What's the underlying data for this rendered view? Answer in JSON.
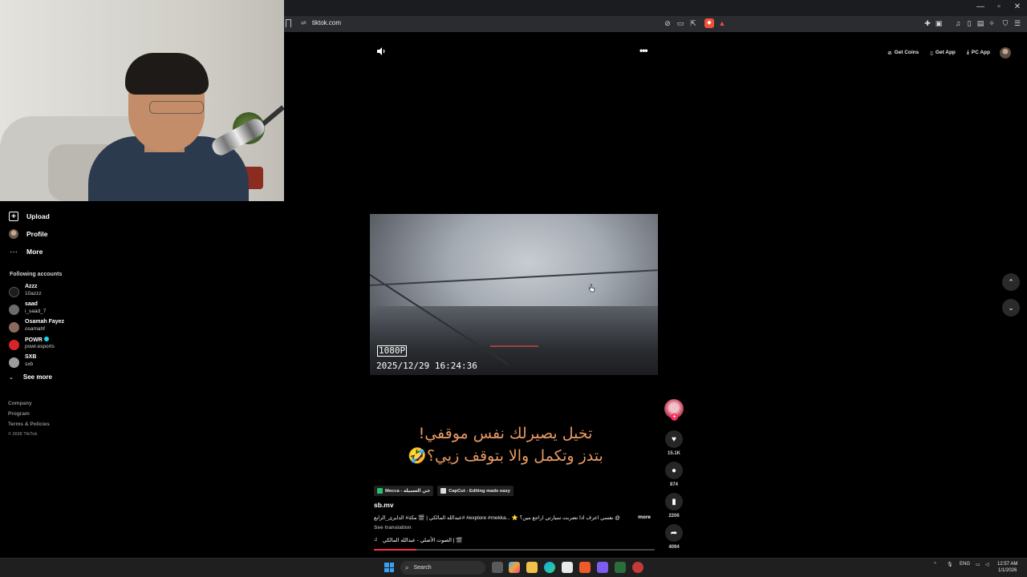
{
  "browser": {
    "url": "tiktok.com",
    "window_controls": [
      "—",
      "▫",
      "✕"
    ]
  },
  "sidebar": {
    "items": [
      {
        "label": "Upload",
        "icon": "upload-icon"
      },
      {
        "label": "Profile",
        "icon": "profile-avatar"
      },
      {
        "label": "More",
        "icon": "more-dots-icon"
      }
    ],
    "following_title": "Following accounts",
    "accounts": [
      {
        "name": "Azzz",
        "handle": "10azzz",
        "color": "#1c1c1c"
      },
      {
        "name": "saad",
        "handle": "i_saad_7",
        "color": "#6b6b6b"
      },
      {
        "name": "Osamah Fayez",
        "handle": "osamahf",
        "color": "#8a6a5e"
      },
      {
        "name": "POWR",
        "handle": "powr.esports",
        "color": "#d6262a",
        "verified": true
      },
      {
        "name": "SXB",
        "handle": "sxb",
        "color": "#9d9d9d"
      }
    ],
    "see_more": "See more",
    "footer": [
      "Company",
      "Program",
      "Terms & Policies"
    ],
    "copyright": "© 2026 TikTok"
  },
  "header_actions": {
    "get_coins": "Get Coins",
    "get_app": "Get App",
    "pc_app": "PC App"
  },
  "video": {
    "resolution_badge": "1080P",
    "timestamp": "2025/12/29 16:24:36",
    "caption_line1": "تخيل يصيرلك نفس موقفي!",
    "caption_line2": "بتدز وتكمل والا بتوقف زيي؟🤣",
    "tags": [
      {
        "label": "Mecca - حي العسيلة",
        "color": "#25c16f"
      },
      {
        "label": "CapCut - Editing made easy",
        "color": "#dddddd"
      }
    ],
    "author": "sb.mv",
    "description": "عبدالله المالكي | 🎬 مكة# الدايرى_الرابع# #explore #mekka... ⭐ نفسي اعرف اذا تضربت سيارتي اراجع مين؟ @",
    "more": "more",
    "see_translation": "See translation",
    "music": "الصوت الأصلي - عبدالله المالكي | 🎬",
    "progress": 0.15
  },
  "actions": {
    "likes": "15.1K",
    "comments": "874",
    "saves": "2206",
    "shares": "4094"
  },
  "taskbar": {
    "search": "Search",
    "lang": "ENG",
    "time": "12:57 AM",
    "date": "1/1/2026"
  }
}
